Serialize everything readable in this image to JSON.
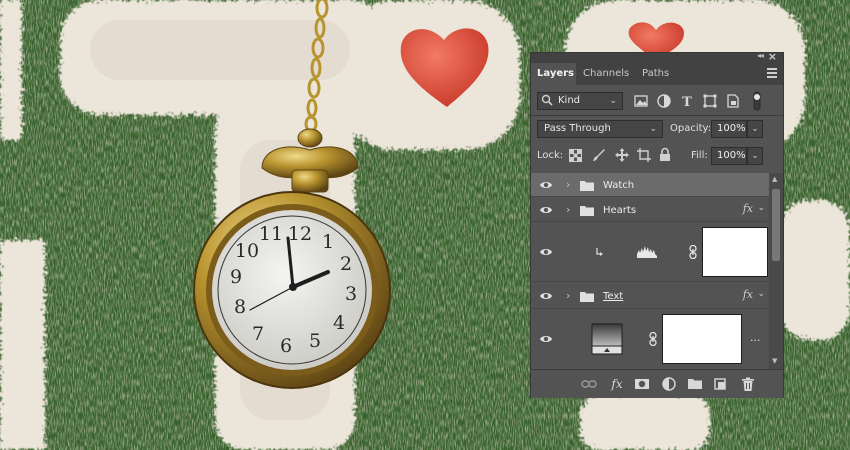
{
  "panel": {
    "tabs": [
      {
        "label": "Layers",
        "active": true
      },
      {
        "label": "Channels",
        "active": false
      },
      {
        "label": "Paths",
        "active": false
      }
    ],
    "filter": {
      "label": "Kind"
    },
    "blend_mode": {
      "label": "Pass Through"
    },
    "opacity": {
      "label": "Opacity:",
      "value": "100%"
    },
    "lock": {
      "label": "Lock:"
    },
    "fill": {
      "label": "Fill:",
      "value": "100%"
    },
    "layers": [
      {
        "name": "Watch",
        "type": "group",
        "selected": true,
        "has_fx": false
      },
      {
        "name": "Hearts",
        "type": "group",
        "selected": false,
        "has_fx": true
      },
      {
        "name": "",
        "type": "adjustment-levels-clipped",
        "selected": false,
        "has_mask": true
      },
      {
        "name": "Text",
        "type": "group",
        "selected": false,
        "has_fx": true
      },
      {
        "name": "",
        "type": "gradient-fill",
        "selected": false,
        "has_mask": true,
        "more": "..."
      }
    ],
    "fx_label": "fx",
    "footer_icons": [
      "link-layers-icon",
      "fx-icon",
      "add-mask-icon",
      "adjustment-layer-icon",
      "new-group-icon",
      "new-layer-icon",
      "trash-icon"
    ]
  },
  "colors": {
    "panel_bg": "#535353",
    "panel_header": "#424242",
    "selected_row": "#6b6b6b",
    "grass": "#3f6a32",
    "fur": "#ece5da",
    "heart": "#e2503d",
    "watch_gold": "#b8942f"
  },
  "watch_dial": [
    "12",
    "1",
    "2",
    "3",
    "4",
    "5",
    "6",
    "7",
    "8",
    "9",
    "10",
    "11"
  ]
}
